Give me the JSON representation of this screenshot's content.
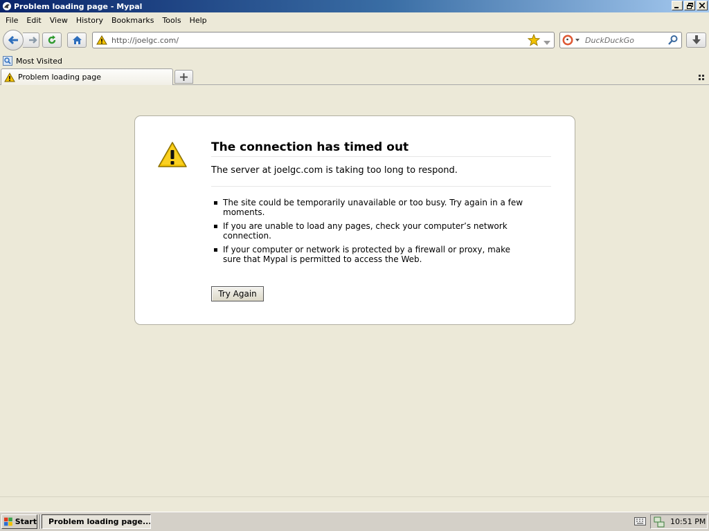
{
  "window": {
    "title": "Problem loading page - Mypal",
    "app_icon": "mypal-icon",
    "controls": [
      "minimize-icon",
      "restore-icon",
      "close-icon"
    ]
  },
  "menubar": {
    "items": [
      {
        "label": "File"
      },
      {
        "label": "Edit"
      },
      {
        "label": "View"
      },
      {
        "label": "History"
      },
      {
        "label": "Bookmarks"
      },
      {
        "label": "Tools"
      },
      {
        "label": "Help"
      }
    ]
  },
  "navbar": {
    "url": "http://joelgc.com/",
    "search_placeholder": "DuckDuckGo",
    "buttons": [
      "back-icon",
      "forward-icon",
      "reload-icon",
      "home-icon",
      "bookmark-star-icon",
      "download-icon"
    ]
  },
  "bookmarks": {
    "items": [
      {
        "label": "Most Visited",
        "icon": "most-visited-icon"
      }
    ]
  },
  "tabs": [
    {
      "label": "Problem loading page",
      "icon": "warning-icon",
      "active": true
    }
  ],
  "error": {
    "title": "The connection has timed out",
    "description": "The server at joelgc.com is taking too long to respond.",
    "suggestions": [
      "The site could be temporarily unavailable or too busy. Try again in a few moments.",
      "If you are unable to load any pages, check your computer’s network connection.",
      "If your computer or network is protected by a firewall or proxy, make sure that Mypal is permitted to access the Web."
    ],
    "button_label": "Try Again"
  },
  "taskbar": {
    "start_label": "Start",
    "task_label": "Problem loading page...",
    "clock": "10:51 PM"
  },
  "colors": {
    "desktop_bg": "#ECE9D8",
    "titlebar_start": "#0A246A",
    "titlebar_end": "#A6CAF0",
    "warning_yellow": "#F2C200",
    "link_blue": "#2E6EBC"
  }
}
